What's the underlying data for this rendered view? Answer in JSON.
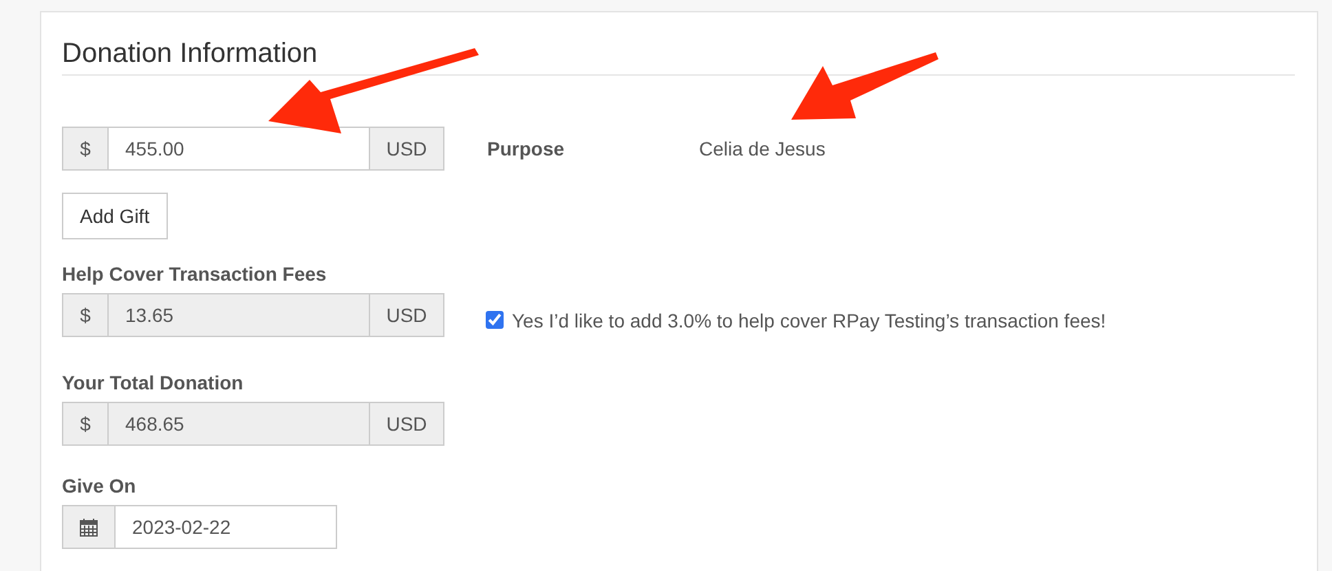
{
  "section": {
    "title": "Donation Information"
  },
  "gift": {
    "currency_symbol": "$",
    "amount": "455.00",
    "currency": "USD",
    "disabled": false
  },
  "purpose": {
    "label": "Purpose",
    "value": "Celia de Jesus"
  },
  "add_gift_button": "Add Gift",
  "fees": {
    "label": "Help Cover Transaction Fees",
    "currency_symbol": "$",
    "amount": "13.65",
    "currency": "USD",
    "disabled": true
  },
  "fee_consent": {
    "checked": true,
    "label": "Yes I’d like to add 3.0% to help cover RPay Testing’s transaction fees!"
  },
  "total": {
    "label": "Your Total Donation",
    "currency_symbol": "$",
    "amount": "468.65",
    "currency": "USD",
    "disabled": true
  },
  "give_on": {
    "label": "Give On",
    "value": "2023-02-22"
  }
}
